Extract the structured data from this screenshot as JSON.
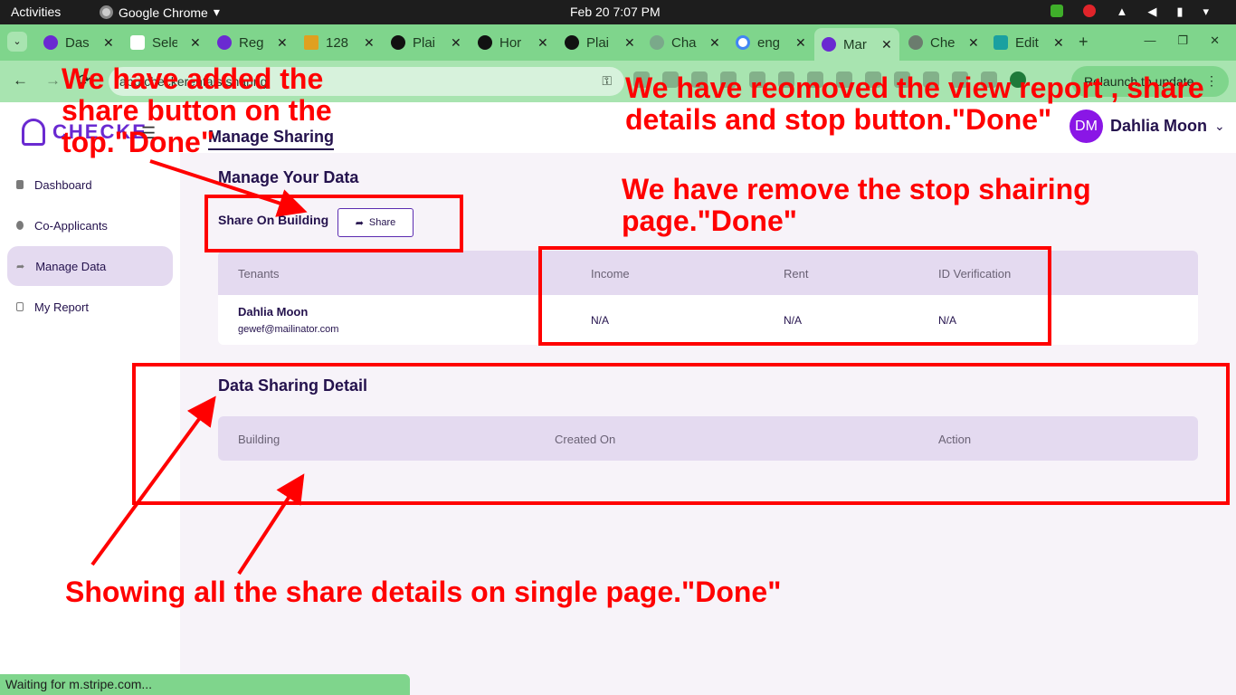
{
  "os": {
    "activities": "Activities",
    "app": "Google Chrome",
    "app_caret": "▾",
    "clock": "Feb 20  7:07 PM"
  },
  "tabs": [
    {
      "label": "Das",
      "close": "✕"
    },
    {
      "label": "Sele",
      "close": "✕"
    },
    {
      "label": "Reg",
      "close": "✕"
    },
    {
      "label": "128",
      "close": "✕"
    },
    {
      "label": "Plai",
      "close": "✕"
    },
    {
      "label": "Hor",
      "close": "✕"
    },
    {
      "label": "Plai",
      "close": "✕"
    },
    {
      "label": "Cha",
      "close": "✕"
    },
    {
      "label": "eng",
      "close": "✕"
    },
    {
      "label": "Mar",
      "close": "✕"
    },
    {
      "label": "Che",
      "close": "✕"
    },
    {
      "label": "Edit",
      "close": "✕"
    }
  ],
  "browser": {
    "tab_menu": "⌄",
    "new_tab": "+",
    "back": "←",
    "forward": "→",
    "reload": "⟳",
    "url": "app.checkerentals/sharing",
    "relaunch": "Relaunch to update",
    "relaunch_menu": "⋮",
    "minimize": "—",
    "maximize": "❐",
    "close_window": "✕",
    "key_icon": "⚿"
  },
  "header": {
    "brand": "CHECKE",
    "hamburger": "☰",
    "page_title": "Manage Sharing",
    "avatar_initials": "DM",
    "user_name": "Dahlia Moon",
    "user_caret": "⌄"
  },
  "sidebar": {
    "items": [
      {
        "label": "Dashboard"
      },
      {
        "label": "Co-Applicants"
      },
      {
        "label": "Manage Data"
      },
      {
        "label": "My Report"
      }
    ]
  },
  "main": {
    "section_title": "Manage Your Data",
    "share_label": "Share On Building",
    "share_button": "Share",
    "share_icon": "➦",
    "tenants_table": {
      "headers": [
        "Tenants",
        "Income",
        "Rent",
        "ID Verification"
      ],
      "rows": [
        {
          "name": "Dahlia Moon",
          "email": "gewef@mailinator.com",
          "income": "N/A",
          "rent": "N/A",
          "id_verification": "N/A"
        }
      ]
    },
    "detail_title": "Data Sharing Detail",
    "detail_table": {
      "headers": [
        "Building",
        "Created On",
        "Action"
      ]
    }
  },
  "annotations": {
    "share_added": "We have added the share button on the top.\"Done\"",
    "removed_view": "We have reomoved the view report , share details and stop button.\"Done\"",
    "removed_stop": "We have remove the stop shairing page.\"Done\"",
    "single_page": "Showing all the share details on single page.\"Done\"",
    "color": "#ff0000"
  },
  "status": {
    "text": "Waiting for m.stripe.com..."
  }
}
